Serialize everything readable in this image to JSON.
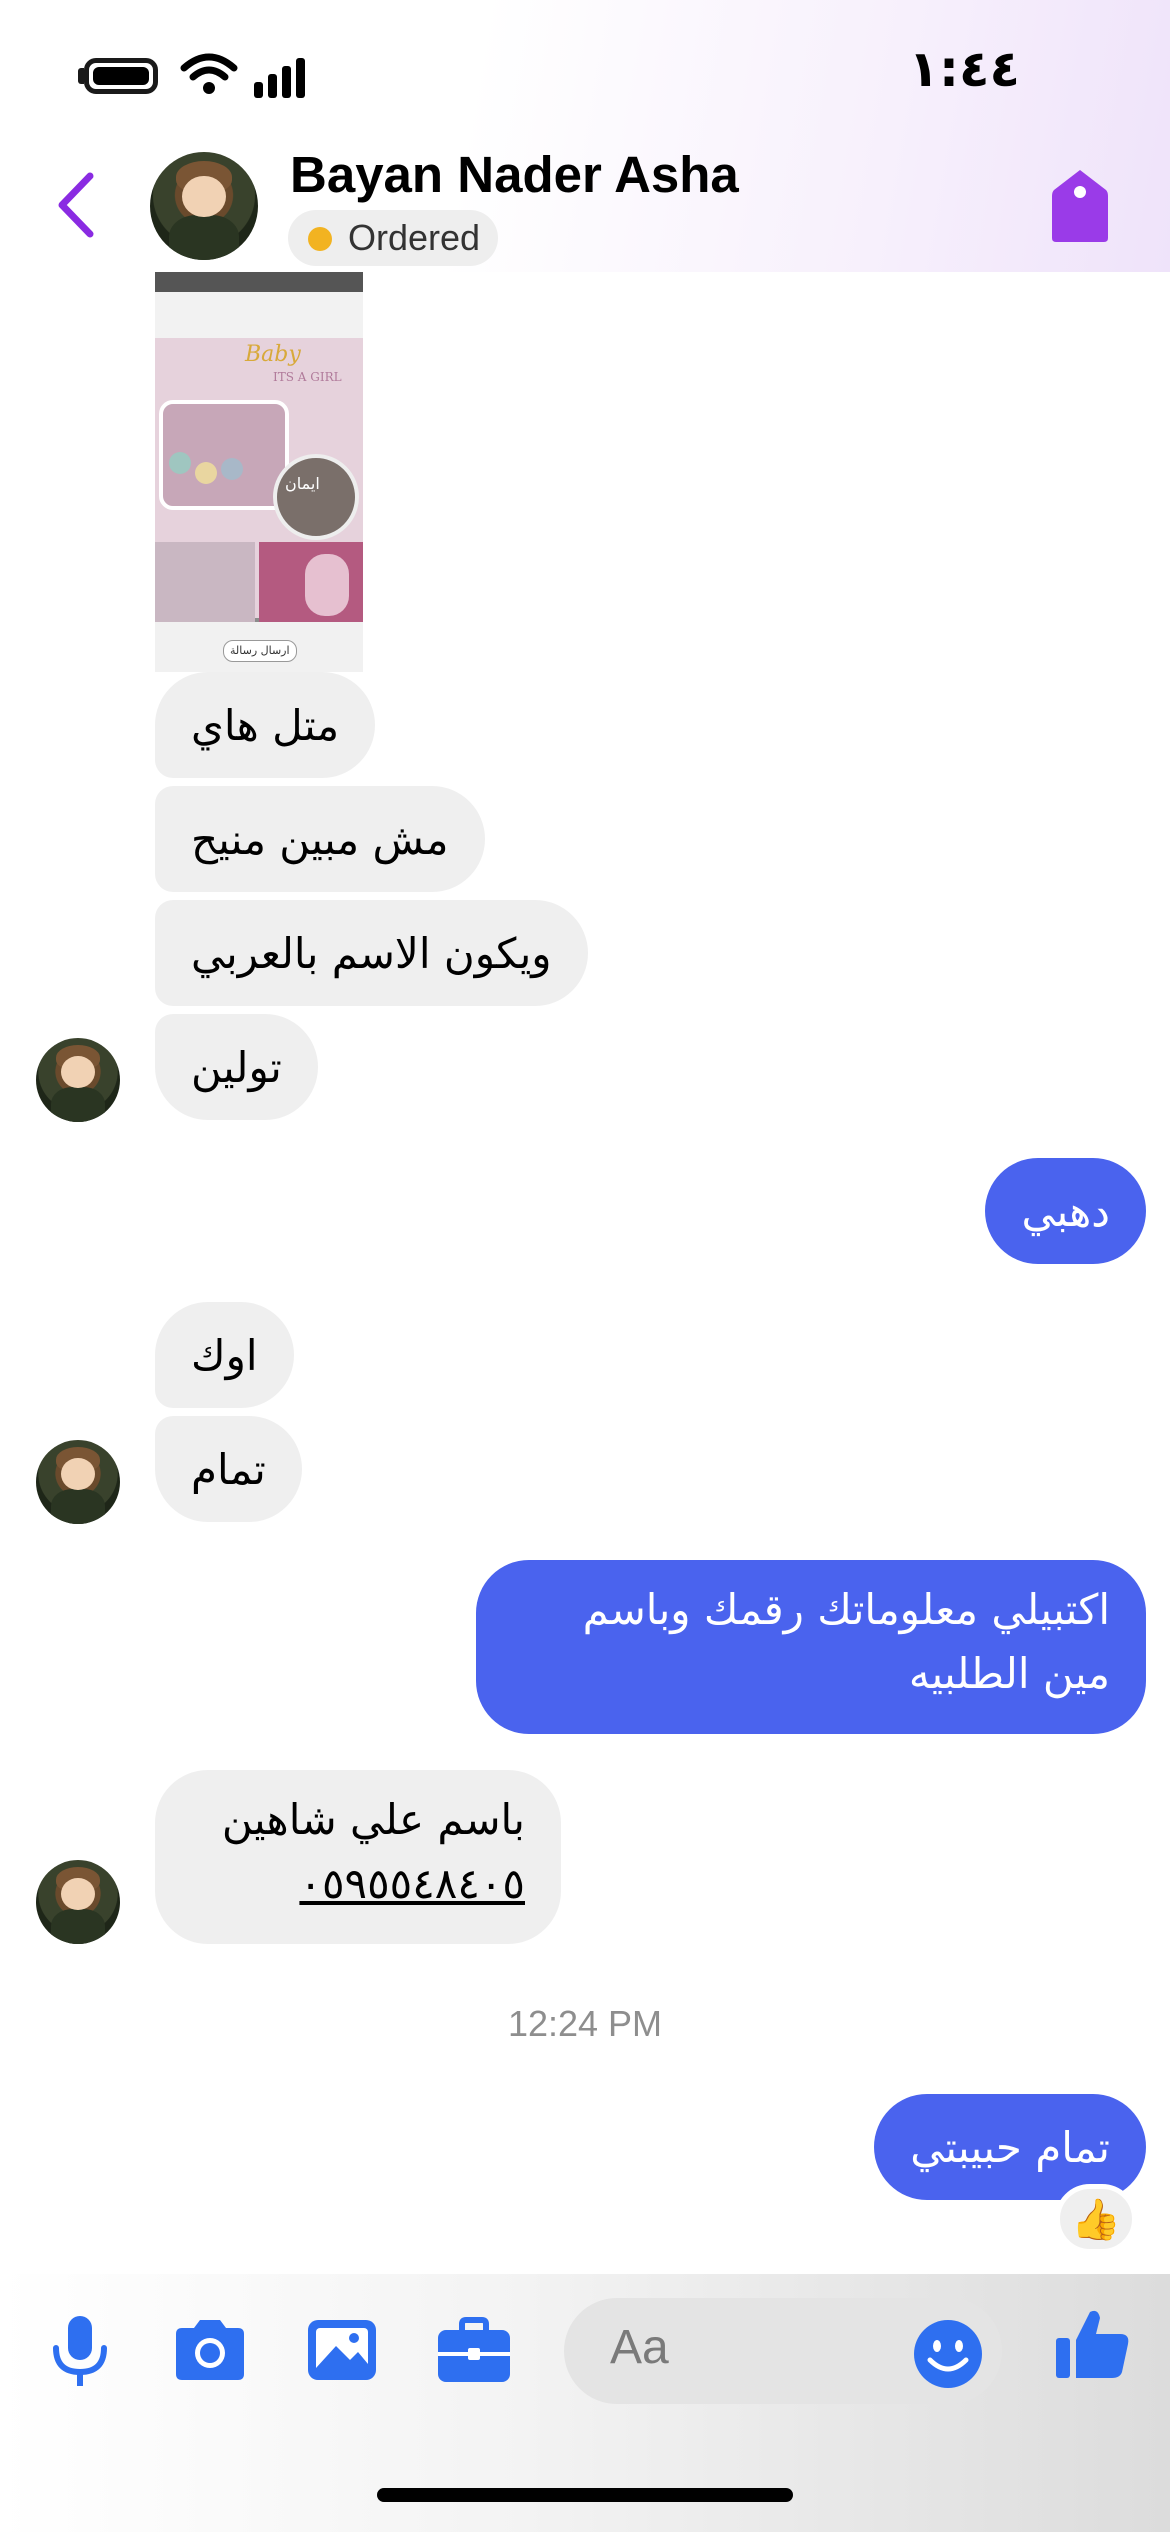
{
  "status_bar": {
    "time": "١:٤٤"
  },
  "header": {
    "contact_name": "Bayan Nader Asha",
    "status_label": "Ordered",
    "status_color": "#f2b321",
    "accent_color": "#8a2be2"
  },
  "attachment": {
    "texts": [
      "Baby",
      "ITS A GIRL",
      "ايمان",
      "ارسال رسالة"
    ]
  },
  "messages": [
    {
      "direction": "in",
      "text": "متل هاي"
    },
    {
      "direction": "in",
      "text": "مش مبين منيح"
    },
    {
      "direction": "in",
      "text": "ويكون الاسم بالعربي"
    },
    {
      "direction": "in",
      "text": "تولين"
    },
    {
      "direction": "out",
      "text": "دهبي"
    },
    {
      "direction": "in",
      "text": "اوك"
    },
    {
      "direction": "in",
      "text": "تمام"
    },
    {
      "direction": "out",
      "line1": "اكتبيلي معلوماتك رقمك وباسم",
      "line2": "مين الطلبيه"
    },
    {
      "direction": "in",
      "line1": "باسم علي شاهين",
      "line2": "٠٥٩٥٥٤٨٤٠٥"
    },
    {
      "direction": "out",
      "text": "تمام حبيبتي",
      "reaction": "👍"
    }
  ],
  "timestamp": "12:24 PM",
  "composer": {
    "placeholder": "Aa",
    "icons": [
      "microphone-icon",
      "camera-icon",
      "gallery-icon",
      "briefcase-icon",
      "emoji-icon",
      "thumbs-up-icon"
    ],
    "icon_color": "#2e6ff0"
  }
}
